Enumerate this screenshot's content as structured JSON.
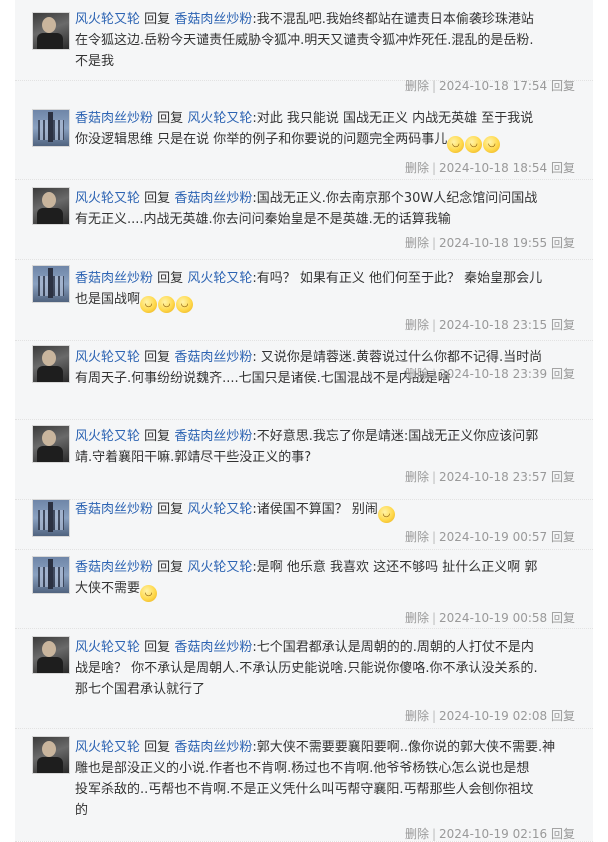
{
  "labels": {
    "reply_word": "回复",
    "delete": "删除",
    "reply_action": "回复"
  },
  "replies": [
    {
      "from": "风火轮又轮",
      "to": "香菇肉丝炒粉",
      "avatar": "a",
      "lines": [
        ":我不混乱吧.我始终都站在谴责日本偷袭珍珠港站",
        "在令狐这边.岳粉今天谴责任威胁令狐冲.明天又谴责令狐冲炸死任.混乱的是岳粉.",
        "不是我"
      ],
      "time": "2024-10-18 17:54"
    },
    {
      "from": "香菇肉丝炒粉",
      "to": "风火轮又轮",
      "avatar": "b",
      "lines": [
        ":对此 我只能说 国战无正义 内战无英雄 至于我说",
        "你没逻辑思维 只是在说 你举的例子和你要说的问题完全两码事儿"
      ],
      "emojis": 3,
      "time": "2024-10-18 18:54"
    },
    {
      "from": "风火轮又轮",
      "to": "香菇肉丝炒粉",
      "avatar": "a",
      "lines": [
        ":国战无正义.你去南京那个30W人纪念馆问问国战",
        "有无正义....内战无英雄.你去问问秦始皇是不是英雄.无的话算我输"
      ],
      "time": "2024-10-18 19:55"
    },
    {
      "from": "香菇肉丝炒粉",
      "to": "风火轮又轮",
      "avatar": "b",
      "lines": [
        ":有吗？ 如果有正义 他们何至于此？ 秦始皇那会儿",
        "也是国战啊"
      ],
      "emojis": 3,
      "time": "2024-10-18 23:15"
    },
    {
      "from": "风火轮又轮",
      "to": "香菇肉丝炒粉",
      "avatar": "a",
      "lines": [
        ": 又说你是靖蓉迷.黄蓉说过什么你都不记得.当时尚",
        "有周天子.何事纷纷说魏齐....七国只是诸侯.七国混战不是内战是啥"
      ],
      "time": "2024-10-18 23:39"
    },
    {
      "from": "风火轮又轮",
      "to": "香菇肉丝炒粉",
      "avatar": "a",
      "lines": [
        ":不好意思.我忘了你是靖迷:国战无正义你应该问郭",
        "靖.守着襄阳干嘛.郭靖尽干些没正义的事?"
      ],
      "time": "2024-10-18 23:57"
    },
    {
      "from": "香菇肉丝炒粉",
      "to": "风火轮又轮",
      "avatar": "b",
      "lines": [
        ":诸侯国不算国？ 别闹"
      ],
      "emojis": 1,
      "time": "2024-10-19 00:57"
    },
    {
      "from": "香菇肉丝炒粉",
      "to": "风火轮又轮",
      "avatar": "b",
      "lines": [
        ":是啊 他乐意 我喜欢 这还不够吗 扯什么正义啊 郭",
        "大侠不需要"
      ],
      "emojis": 1,
      "time": "2024-10-19 00:58"
    },
    {
      "from": "风火轮又轮",
      "to": "香菇肉丝炒粉",
      "avatar": "a",
      "lines": [
        ":七个国君都承认是周朝的的.周朝的人打仗不是内",
        "战是啥？ 你不承认是周朝人.不承认历史能说啥.只能说你傻咯.你不承认没关系的.",
        "那七个国君承认就行了"
      ],
      "time": "2024-10-19 02:08"
    },
    {
      "from": "风火轮又轮",
      "to": "香菇肉丝炒粉",
      "avatar": "a",
      "lines": [
        ":郭大侠不需要要襄阳要啊..像你说的郭大侠不需要.神",
        "雕也是部没正义的小说.作者也不肯啊.杨过也不肯啊.他爷爷杨铁心怎么说也是想",
        "投军杀敌的..丐帮也不肯啊.不是正义凭什么叫丐帮守襄阳.丐帮那些人会刨你祖坟",
        "的"
      ],
      "time": "2024-10-19 02:16"
    }
  ]
}
